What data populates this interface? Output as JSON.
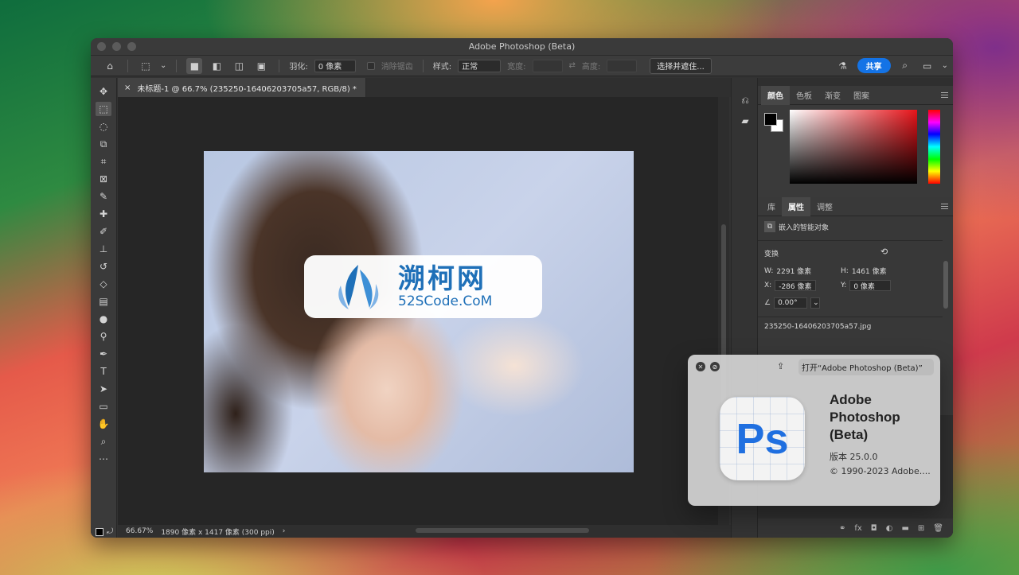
{
  "window": {
    "title": "Adobe Photoshop (Beta)"
  },
  "options_bar": {
    "feather_label": "羽化:",
    "feather_value": "0 像素",
    "antialias_label": "消除锯齿",
    "style_label": "样式:",
    "style_value": "正常",
    "width_label": "宽度:",
    "height_label": "高度:",
    "select_mask_label": "选择并遮住...",
    "share_label": "共享"
  },
  "document": {
    "tab_title": "未标题-1 @ 66.7% (235250-16406203705a57, RGB/8) *",
    "zoom": "66.67%",
    "dimensions": "1890 像素 x 1417 像素 (300 ppi)"
  },
  "watermark": {
    "title": "溯柯网",
    "subtitle": "52SCode.CoM"
  },
  "color_panel": {
    "tabs": [
      "颜色",
      "色板",
      "渐变",
      "图案"
    ],
    "foreground": "#000000",
    "background": "#ffffff"
  },
  "properties_panel": {
    "tabs": [
      "库",
      "属性",
      "调整"
    ],
    "layer_type": "嵌入的智能对象",
    "transform_label": "变换",
    "w_label": "W:",
    "w_value": "2291 像素",
    "h_label": "H:",
    "h_value": "1461 像素",
    "x_label": "X:",
    "x_value": "-286 像素",
    "y_label": "Y:",
    "y_value": "0 像素",
    "angle_value": "0.00°",
    "filename": "235250-16406203705a57.jpg"
  },
  "about_dialog": {
    "open_label": "打开“Adobe Photoshop (Beta)”",
    "app_name": "Adobe Photoshop (Beta)",
    "icon_text": "Ps",
    "version": "版本 25.0.0",
    "copyright": "© 1990-2023 Adobe...."
  },
  "colors": {
    "accent": "#1473e6",
    "panel_bg": "#2f2f2f",
    "ps_blue": "#1f6fe0"
  }
}
